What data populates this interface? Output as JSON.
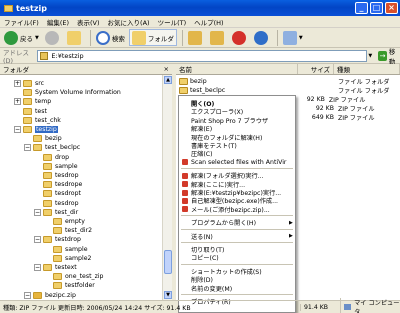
{
  "window": {
    "title": "testzip"
  },
  "menu": [
    "ファイル(F)",
    "編集(E)",
    "表示(V)",
    "お気に入り(A)",
    "ツール(T)",
    "ヘルプ(H)"
  ],
  "toolbar": {
    "back": "戻る",
    "search": "検索",
    "folders": "フォルダ"
  },
  "address": {
    "label": "アドレス(D)",
    "path": "E:¥testzip",
    "go": "移動"
  },
  "tree": {
    "header": "フォルダ",
    "close": "×",
    "items": [
      {
        "label": "src",
        "level": 2,
        "expander": "+"
      },
      {
        "label": "System Volume Information",
        "level": 2,
        "expander": ""
      },
      {
        "label": "temp",
        "level": 2,
        "expander": "+"
      },
      {
        "label": "test",
        "level": 2,
        "expander": ""
      },
      {
        "label": "test_chk",
        "level": 2,
        "expander": ""
      },
      {
        "label": "testzip",
        "level": 2,
        "expander": "−",
        "selected": true
      },
      {
        "label": "bezip",
        "level": 3,
        "expander": ""
      },
      {
        "label": "test_beclpc",
        "level": 3,
        "expander": "−"
      },
      {
        "label": "drop",
        "level": 4,
        "expander": ""
      },
      {
        "label": "sample",
        "level": 4,
        "expander": ""
      },
      {
        "label": "tesdrop",
        "level": 4,
        "expander": ""
      },
      {
        "label": "tesdrope",
        "level": 4,
        "expander": ""
      },
      {
        "label": "tesdropt",
        "level": 4,
        "expander": ""
      },
      {
        "label": "tesdrop",
        "level": 4,
        "expander": ""
      },
      {
        "label": "test_dir",
        "level": 4,
        "expander": "−"
      },
      {
        "label": "empty",
        "level": 5,
        "expander": ""
      },
      {
        "label": "test_dir2",
        "level": 5,
        "expander": ""
      },
      {
        "label": "testdrop",
        "level": 4,
        "expander": "−"
      },
      {
        "label": "sample",
        "level": 5,
        "expander": ""
      },
      {
        "label": "sample2",
        "level": 5,
        "expander": ""
      },
      {
        "label": "testext",
        "level": 4,
        "expander": "−"
      },
      {
        "label": "one_test_zip",
        "level": 5,
        "expander": ""
      },
      {
        "label": "testfolder",
        "level": 5,
        "expander": ""
      },
      {
        "label": "bezipc.zip",
        "level": 3,
        "expander": "−"
      }
    ]
  },
  "files": {
    "columns": [
      "名前",
      "サイズ",
      "種類"
    ],
    "rows": [
      {
        "name": "bezip",
        "size": "",
        "kind": "ファイル フォルダ",
        "icon": "folder"
      },
      {
        "name": "test_beclpc",
        "size": "",
        "kind": "ファイル フォルダ",
        "icon": "folder"
      },
      {
        "name": "bezipc.zip",
        "size": "92 KB",
        "kind": "ZIP ファイル",
        "icon": "zip",
        "selected": true
      },
      {
        "name": "",
        "size": "92 KB",
        "kind": "ZIP ファイル",
        "icon": "zip"
      },
      {
        "name": "",
        "size": "649 KB",
        "kind": "ZIP ファイル",
        "icon": "zip"
      }
    ]
  },
  "context_menu": {
    "items": [
      {
        "label": "開く(O)",
        "bold": true
      },
      {
        "label": "エクスプローラ(X)"
      },
      {
        "label": "Paint Shop Pro 7 ブラウザ"
      },
      {
        "label": "解凍(E)"
      },
      {
        "label": "現在のフォルダに解凍(H)"
      },
      {
        "label": "書庫をテスト(T)"
      },
      {
        "label": "圧縮(C)"
      },
      {
        "label": "Scan selected files with AntiVir",
        "icon": "red"
      },
      "sep",
      {
        "label": "解凍(フォルダ選択)実行...",
        "icon": "red"
      },
      {
        "label": "解凍(ここに)実行...",
        "icon": "red"
      },
      {
        "label": "解凍(E:¥testzip¥bezipc)実行...",
        "icon": "red"
      },
      {
        "label": "自己解凍型(bezipc.exe)作成...",
        "icon": "red"
      },
      {
        "label": "メール(ご添付bezipc.zip)...",
        "icon": "red"
      },
      "sep",
      {
        "label": "プログラムから開く(H)",
        "submenu": true
      },
      "sep",
      {
        "label": "送る(N)",
        "submenu": true
      },
      "sep",
      {
        "label": "切り取り(T)"
      },
      {
        "label": "コピー(C)"
      },
      "sep",
      {
        "label": "ショートカットの作成(S)"
      },
      {
        "label": "削除(D)"
      },
      {
        "label": "名前の変更(M)"
      },
      "sep",
      {
        "label": "プロパティ(R)"
      }
    ]
  },
  "status": {
    "text": "種類: ZIP ファイル 更新日時: 2006/05/24 14:24 サイズ: 91.4 KB",
    "size": "91.4 KB",
    "location": "マイ コンピュータ"
  },
  "colors": {
    "title_bar": "#0245c5",
    "selection": "#316ac5",
    "folder": "#f0cf6a"
  }
}
